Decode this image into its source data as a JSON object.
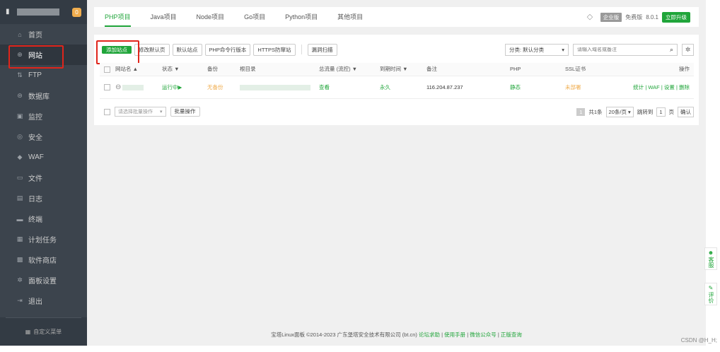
{
  "sidebar": {
    "badge": "0",
    "items": [
      {
        "icon": "home-icon",
        "glyph": "⌂",
        "label": "首页"
      },
      {
        "icon": "globe-icon",
        "glyph": "⊕",
        "label": "网站"
      },
      {
        "icon": "ftp-icon",
        "glyph": "⇅",
        "label": "FTP"
      },
      {
        "icon": "database-icon",
        "glyph": "⊜",
        "label": "数据库"
      },
      {
        "icon": "monitor-icon",
        "glyph": "▣",
        "label": "监控"
      },
      {
        "icon": "shield-icon",
        "glyph": "◎",
        "label": "安全"
      },
      {
        "icon": "waf-shield-icon",
        "glyph": "◆",
        "label": "WAF"
      },
      {
        "icon": "folder-icon",
        "glyph": "▭",
        "label": "文件"
      },
      {
        "icon": "log-icon",
        "glyph": "▤",
        "label": "日志"
      },
      {
        "icon": "terminal-icon",
        "glyph": "▬",
        "label": "终端"
      },
      {
        "icon": "calendar-icon",
        "glyph": "▦",
        "label": "计划任务"
      },
      {
        "icon": "apps-icon",
        "glyph": "▩",
        "label": "软件商店"
      },
      {
        "icon": "settings-icon",
        "glyph": "✲",
        "label": "面板设置"
      },
      {
        "icon": "logout-icon",
        "glyph": "⇥",
        "label": "退出"
      }
    ],
    "custom_menu": "自定义菜单"
  },
  "tabs": [
    "PHP项目",
    "Java项目",
    "Node项目",
    "Go项目",
    "Python项目",
    "其他项目"
  ],
  "version": {
    "edition": "企业版",
    "free": "免费版",
    "number": "8.0.1",
    "upgrade": "立即升级"
  },
  "toolbar": {
    "add": "添加站点",
    "default_page": "修改默认页",
    "default_site": "默认站点",
    "php_cli": "PHP命令行版本",
    "https": "HTTPS防窜站",
    "retrieve": "漏洞扫描",
    "category": "分类: 默认分类",
    "search_placeholder": "请输入域名或备注"
  },
  "table": {
    "headers": [
      "网站名 ▲",
      "状态 ▼",
      "备份",
      "根目录",
      "总流量 (流控) ▼",
      "到期时间 ▼",
      "备注",
      "PHP",
      "SSL证书",
      "操作"
    ],
    "row": {
      "status": "运行中▶",
      "backup": "无备份",
      "traffic": "查看",
      "expire": "永久",
      "note": "116.204.87.237",
      "php": "静态",
      "ssl": "未部署",
      "actions": [
        "统计",
        "WAF",
        "设置",
        "删除"
      ]
    }
  },
  "footer": {
    "batch_placeholder": "请选择批量操作",
    "batch_btn": "批量操作",
    "page": "1",
    "total": "共1条",
    "per_page": "20条/页",
    "goto": "跳转到",
    "goto_page": "1",
    "page_unit": "页",
    "confirm": "确认"
  },
  "copyright": {
    "text": "宝塔Linux面板 ©2014-2023 广东堡塔安全技术有限公司 (bt.cn)",
    "links": [
      "论坛求助",
      "使用手册",
      "微信公众号",
      "正版查询"
    ]
  },
  "float": {
    "service": "客服",
    "review": "评价"
  },
  "watermark": "CSDN @H_H;"
}
